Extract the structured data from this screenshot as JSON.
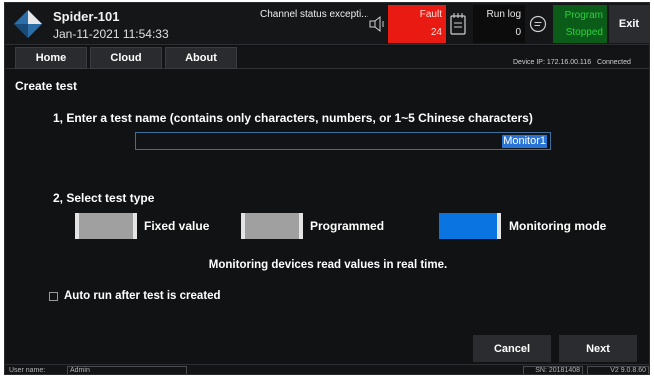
{
  "header": {
    "device_name": "Spider-101",
    "datetime": "Jan-11-2021 11:54:33",
    "channel_status": "Channel status excepti...",
    "fault": {
      "label": "Fault",
      "count": "24"
    },
    "run_log": {
      "label": "Run log",
      "count": "0"
    },
    "program": {
      "line1": "Program",
      "line2": "Stopped"
    },
    "exit_label": "Exit",
    "icons": [
      "logo-icon",
      "speaker-icon",
      "notes-icon",
      "chat-icon"
    ]
  },
  "nav": {
    "tabs": [
      {
        "label": "Home"
      },
      {
        "label": "Cloud"
      },
      {
        "label": "About"
      }
    ],
    "device_ip_label": "Device IP: 172.16.00.116",
    "connection_status": "Connected"
  },
  "content": {
    "title": "Create test",
    "step1_label": "1, Enter a test name (contains only characters, numbers, or 1~5 Chinese characters)",
    "test_name_value": "Monitor1",
    "step2_label": "2, Select test type",
    "test_types": [
      {
        "label": "Fixed value",
        "selected": false
      },
      {
        "label": "Programmed",
        "selected": false
      },
      {
        "label": "Monitoring mode",
        "selected": true
      }
    ],
    "description": "Monitoring devices read values in real time.",
    "auto_run_label": "Auto run after test is created",
    "auto_run_checked": false,
    "cancel_label": "Cancel",
    "next_label": "Next"
  },
  "status_bar": {
    "user_label": "User name:",
    "user_value": "Admin",
    "sn": "SN: 20181408",
    "version": "V2  9.0.8.60"
  },
  "colors": {
    "background": "#111214",
    "fault": "#e81a12",
    "program_bg": "#0b5c18",
    "program_text": "#2cd240",
    "selected_type": "#0a74e0",
    "unselected_type": "#a0a0a0"
  }
}
